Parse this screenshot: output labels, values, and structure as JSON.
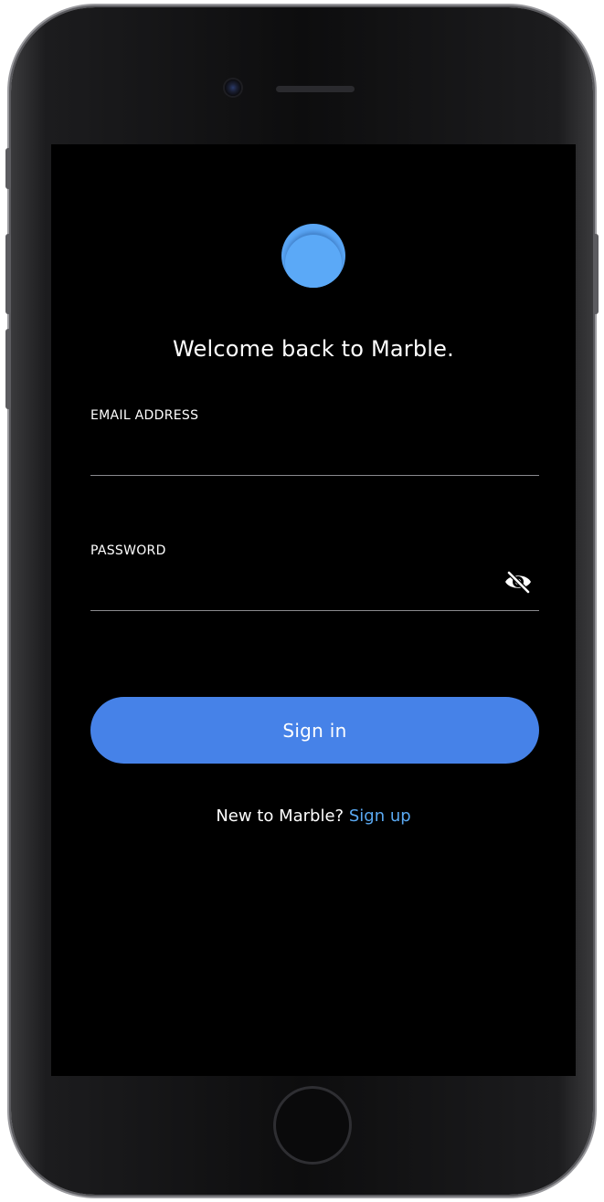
{
  "app": {
    "name": "Marble",
    "brand_color": "#5aa6f5",
    "accent_color": "#4682e8",
    "link_color": "#5aa9f2"
  },
  "login": {
    "heading": "Welcome back to Marble.",
    "email": {
      "label": "EMAIL ADDRESS",
      "value": "",
      "placeholder": ""
    },
    "password": {
      "label": "PASSWORD",
      "value": "",
      "placeholder": "",
      "visibility_icon": "eye-off-icon"
    },
    "submit_label": "Sign in",
    "signup_prompt": "New to Marble?",
    "signup_link": "Sign up"
  }
}
